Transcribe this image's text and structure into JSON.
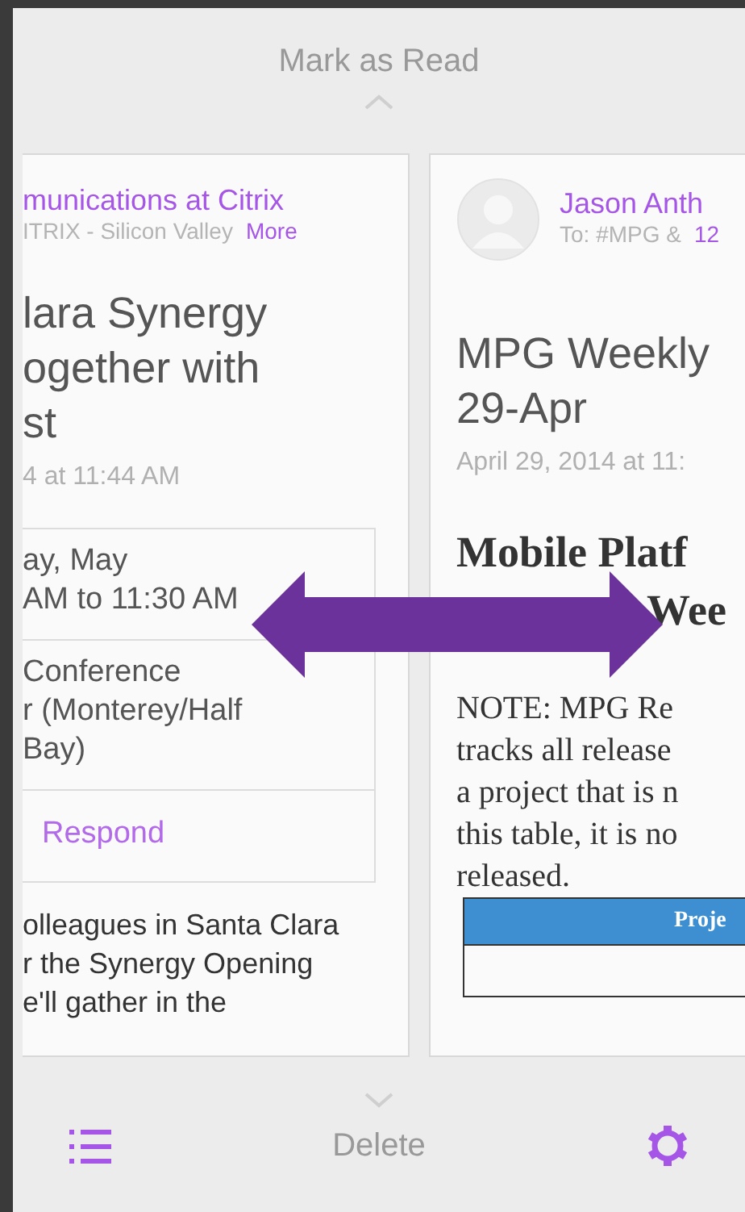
{
  "top_action": {
    "label": "Mark as Read"
  },
  "left_card": {
    "sender": "munications at Citrix",
    "account": "ITRIX - Silicon Valley",
    "more": "More",
    "subject_lines": [
      "lara Synergy",
      "ogether with",
      "st"
    ],
    "date": "4 at 11:44 AM",
    "event": {
      "when_lines": [
        "ay, May",
        "AM to 11:30 AM"
      ],
      "where_lines": [
        "Conference",
        "r (Monterey/Half",
        "Bay)"
      ],
      "respond": "Respond"
    },
    "body_lines": [
      "olleagues in Santa Clara",
      "r the Synergy Opening",
      "e'll gather in the"
    ]
  },
  "right_card": {
    "sender": "Jason Anth",
    "recipient": "To: #MPG &",
    "recipient_count": "12",
    "subject_lines": [
      "MPG Weekly",
      "29-Apr"
    ],
    "date": "April 29, 2014 at 11:",
    "heading_lines": [
      "Mobile Platf",
      "Wee"
    ],
    "note_lines": [
      "NOTE:  MPG Re",
      "tracks all release",
      "a project that is n",
      "this table, it is no",
      "released."
    ],
    "table_header": "Proje"
  },
  "bottom_action": {
    "label": "Delete"
  }
}
